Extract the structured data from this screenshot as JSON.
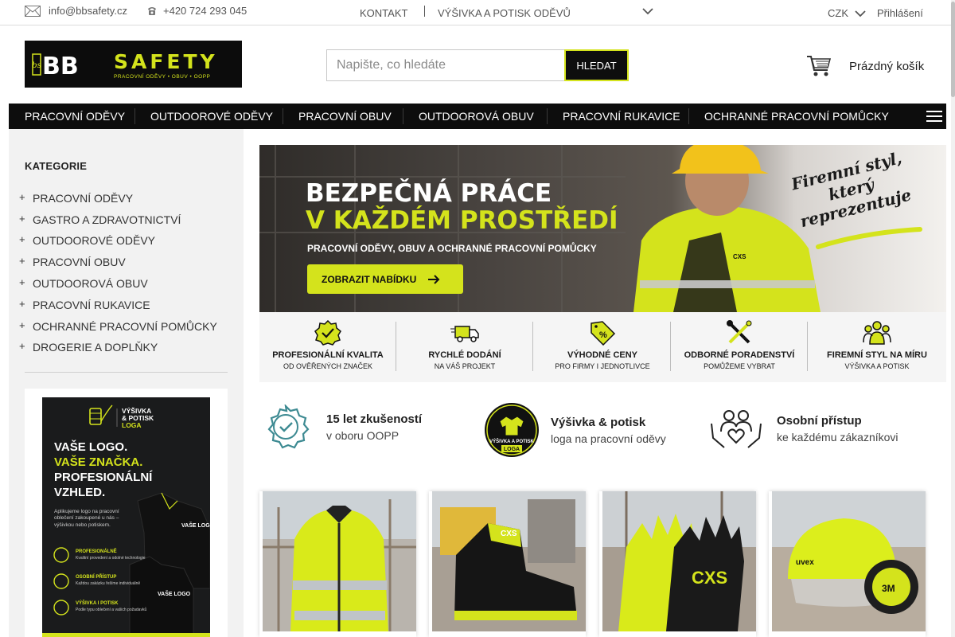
{
  "topbar": {
    "email": "info@bbsafety.cz",
    "phone": "+420 724 293 045",
    "kontakt": "KONTAKT",
    "vysivka": "VÝŠIVKA A POTISK ODĚVŮ",
    "currency": "CZK",
    "login": "Přihlášení"
  },
  "logo": {
    "brand_left": "BB",
    "brand_right": "SAFETY",
    "tagline": "PRACOVNÍ ODĚVY • OBUV • OOPP"
  },
  "search": {
    "placeholder": "Napište, co hledáte",
    "value": "",
    "button": "HLEDAT"
  },
  "cart": {
    "label": "Prázdný košík"
  },
  "nav": {
    "items": [
      "PRACOVNÍ ODĚVY",
      "OUTDOOROVÉ ODĚVY",
      "PRACOVNÍ OBUV",
      "OUTDOOROVÁ OBUV",
      "PRACOVNÍ RUKAVICE",
      "OCHRANNÉ PRACOVNÍ POMŮCKY"
    ]
  },
  "sidebar": {
    "heading": "KATEGORIE",
    "categories": [
      "PRACOVNÍ ODĚVY",
      "GASTRO A ZDRAVOTNICTVÍ",
      "OUTDOOROVÉ ODĚVY",
      "PRACOVNÍ OBUV",
      "OUTDOOROVÁ OBUV",
      "PRACOVNÍ RUKAVICE",
      "OCHRANNÉ PRACOVNÍ POMŮCKY",
      "DROGERIE A DOPLŇKY"
    ],
    "promo": {
      "badge_line1": "VÝŠIVKA",
      "badge_line2": "& POTISK",
      "badge_line3": "LOGA",
      "headline_1": "VAŠE LOGO.",
      "headline_2": "VAŠE ZNAČKA.",
      "headline_3": "PROFESIONÁLNÍ",
      "headline_4": "VZHLED.",
      "body": "Aplikujeme logo na pracovní oblečení zakoupené u nás – výšivkou nebo potiskem.",
      "logo_text_1": "VAŠE LOGO",
      "logo_text_2": "VAŠE LOGO",
      "b1_title": "PROFESIONÁLNĚ",
      "b1_sub": "Kvalitní provedení a odolné technologie",
      "b2_title": "OSOBNÍ PŘÍSTUP",
      "b2_sub": "Každou zakázku řešíme individuálně",
      "b3_title": "VÝŠIVKA I POTISK",
      "b3_sub": "Podle typu oblečení a vašich požadavků"
    }
  },
  "hero": {
    "line1": "BEZPEČNÁ PRÁCE",
    "line2": "V KAŽDÉM PROSTŘEDÍ",
    "subtitle": "PRACOVNÍ ODĚVY, OBUV A OCHRANNÉ PRACOVNÍ POMŮCKY",
    "cta": "ZOBRAZIT NABÍDKU",
    "slogan_1": "Firemní styl,",
    "slogan_2": "který",
    "slogan_3": "reprezentuje",
    "jacket_brand": "CXS"
  },
  "features": [
    {
      "title": "PROFESIONÁLNÍ KVALITA",
      "sub": "OD OVĚŘENÝCH ZNAČEK"
    },
    {
      "title": "RYCHLÉ DODÁNÍ",
      "sub": "NA VÁŠ PROJEKT"
    },
    {
      "title": "VÝHODNÉ CENY",
      "sub": "PRO FIRMY I JEDNOTLIVCE"
    },
    {
      "title": "ODBORNÉ PORADENSTVÍ",
      "sub": "POMŮŽEME VYBRAT"
    },
    {
      "title": "FIREMNÍ STYL NA MÍRU",
      "sub": "VÝŠIVKA A POTISK"
    }
  ],
  "usp": [
    {
      "title": "15 let zkušeností",
      "sub": "v oboru OOPP"
    },
    {
      "title": "Výšivka & potisk",
      "sub": "loga na pracovní oděvy",
      "badge_1": "VÝŠIVKA A POTISK",
      "badge_2": "LOGA"
    },
    {
      "title": "Osobní přístup",
      "sub": "ke každému zákazníkovi"
    }
  ],
  "products": {
    "boot_brand": "CXS",
    "glove_brand": "CXS",
    "helmet_brand": "uvex",
    "earmuff_brand": "3M"
  },
  "colors": {
    "accent": "#d4e31c",
    "dark": "#0d0d0d",
    "sidebar_bg": "#f2f2f2"
  }
}
